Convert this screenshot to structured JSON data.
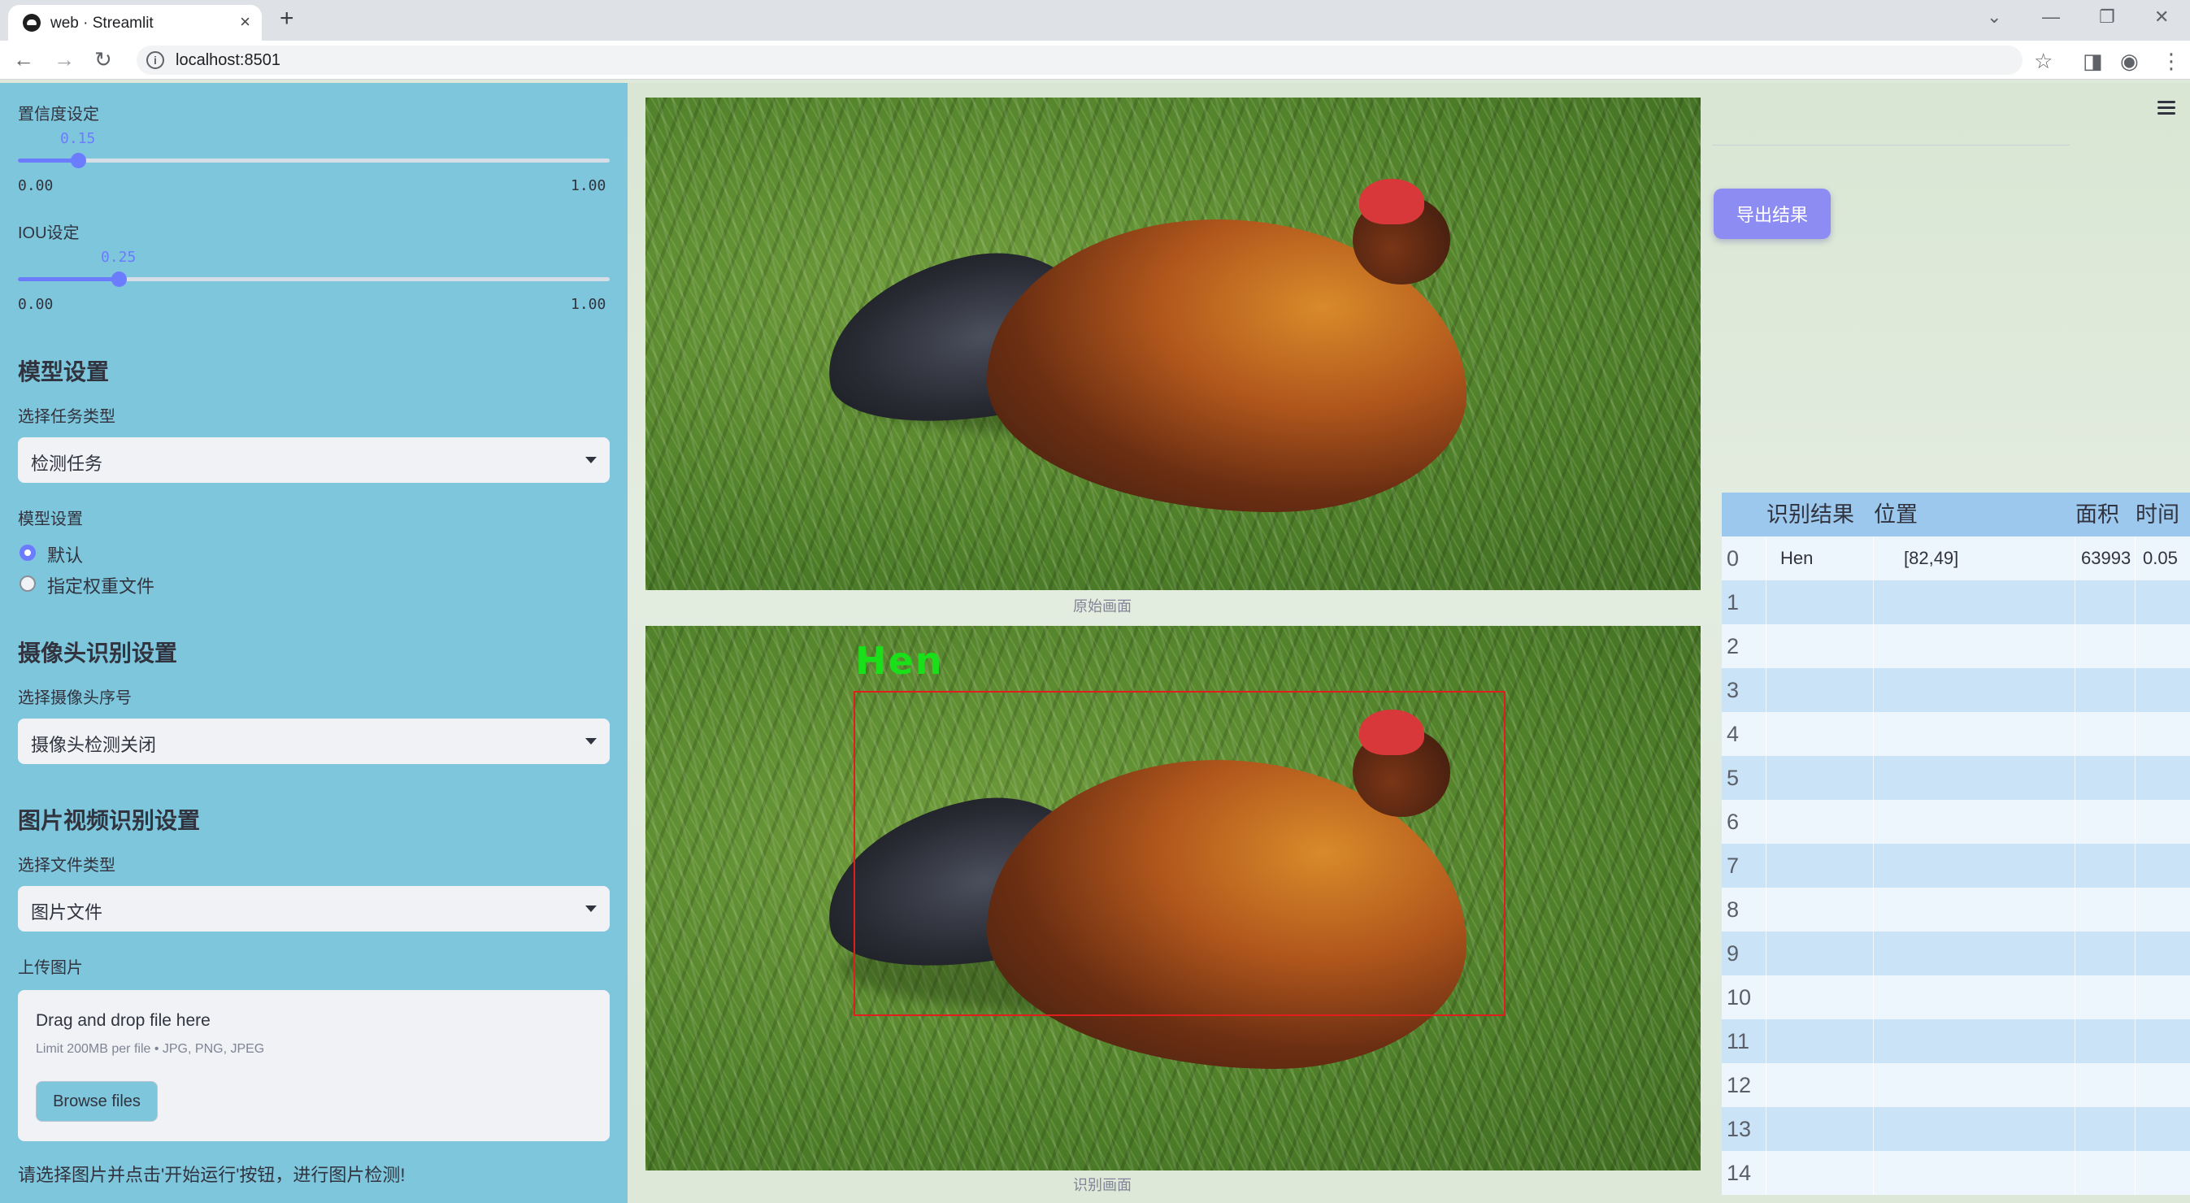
{
  "browser": {
    "tab_title": "web · Streamlit",
    "url": "localhost:8501"
  },
  "sidebar": {
    "confidence": {
      "label": "置信度设定",
      "value": "0.15",
      "min": "0.00",
      "max": "1.00",
      "fraction": 0.15
    },
    "iou": {
      "label": "IOU设定",
      "value": "0.25",
      "min": "0.00",
      "max": "1.00",
      "fraction": 0.25
    },
    "model_section": {
      "heading": "模型设置",
      "task_label": "选择任务类型",
      "task_value": "检测任务",
      "model_label": "模型设置",
      "options": [
        "默认",
        "指定权重文件"
      ],
      "selected": 0
    },
    "camera_section": {
      "heading": "摄像头识别设置",
      "label": "选择摄像头序号",
      "value": "摄像头检测关闭"
    },
    "media_section": {
      "heading": "图片视频识别设置",
      "file_type_label": "选择文件类型",
      "file_type_value": "图片文件",
      "upload_label": "上传图片",
      "drop_text": "Drag and drop file here",
      "limit_text": "Limit 200MB per file • JPG, PNG, JPEG",
      "browse_label": "Browse files"
    },
    "hint": "请选择图片并点击'开始运行'按钮，进行图片检测!"
  },
  "main": {
    "original_caption": "原始画面",
    "result_caption": "识别画面",
    "detection_label": "Hen",
    "export_label": "导出结果"
  },
  "table": {
    "columns": [
      "识别结果",
      "位置",
      "面积",
      "时间"
    ],
    "rows": [
      {
        "index": "0",
        "result": "Hen",
        "position": "[82,49]",
        "area": "63993",
        "time": "0.05"
      },
      {
        "index": "1"
      },
      {
        "index": "2"
      },
      {
        "index": "3"
      },
      {
        "index": "4"
      },
      {
        "index": "5"
      },
      {
        "index": "6"
      },
      {
        "index": "7"
      },
      {
        "index": "8"
      },
      {
        "index": "9"
      },
      {
        "index": "10"
      },
      {
        "index": "11"
      },
      {
        "index": "12"
      },
      {
        "index": "13"
      },
      {
        "index": "14"
      }
    ]
  },
  "colors": {
    "sidebar_bg": "#7ec6db",
    "accent": "#6c7cff",
    "export_button": "#8d8cf2",
    "table_header": "#9cc8ee",
    "detection_box": "#e01e1e",
    "detection_label": "#19e019"
  },
  "icons": [
    "streamlit-favicon",
    "close-icon",
    "plus-icon",
    "back-arrow-icon",
    "forward-arrow-icon",
    "reload-icon",
    "info-icon",
    "star-icon",
    "sidepanel-icon",
    "profile-icon",
    "more-vert-icon",
    "hamburger-menu-icon",
    "chevron-down-icon"
  ]
}
